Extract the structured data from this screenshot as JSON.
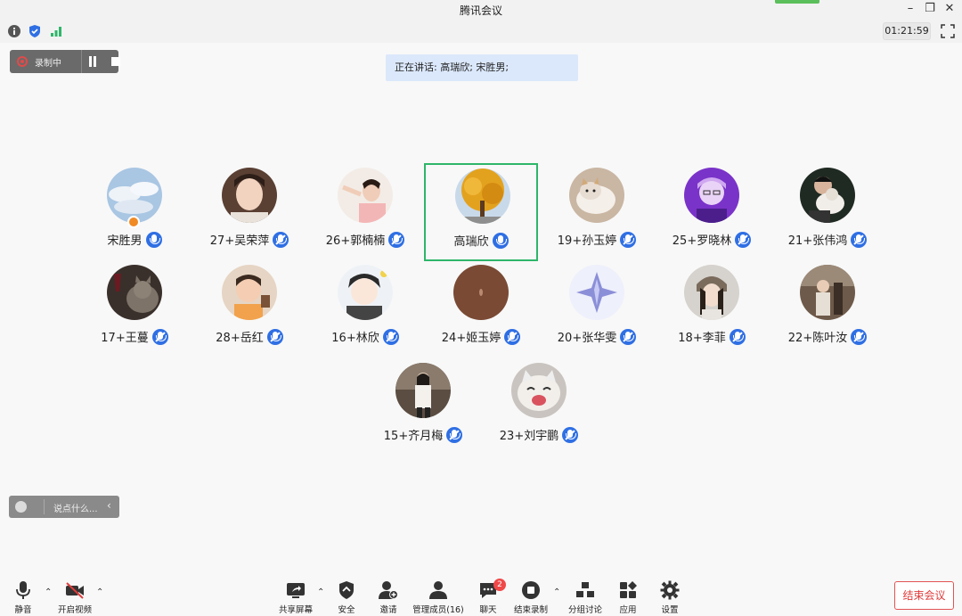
{
  "window": {
    "title": "腾讯会议",
    "timer": "01:21:59"
  },
  "recording": {
    "status_label": "录制中"
  },
  "speaking_banner": "正在讲话: 高瑞欣; 宋胜男;",
  "participants": [
    {
      "name": "宋胜男",
      "mic": "on",
      "avatar": "sky-clouds",
      "host": true
    },
    {
      "name": "27+吴荣萍",
      "mic": "muted",
      "avatar": "girl-portrait"
    },
    {
      "name": "26+郭楠楠",
      "mic": "muted",
      "avatar": "girl-pose"
    },
    {
      "name": "高瑞欣",
      "mic": "on",
      "avatar": "yellow-tree",
      "active_speaker": true
    },
    {
      "name": "19+孙玉婷",
      "mic": "muted",
      "avatar": "cat"
    },
    {
      "name": "25+罗晓林",
      "mic": "muted",
      "avatar": "purple-character"
    },
    {
      "name": "21+张伟鸿",
      "mic": "muted",
      "avatar": "person-with-cat"
    },
    {
      "name": "17+王蔓",
      "mic": "muted",
      "avatar": "cat-and-wine"
    },
    {
      "name": "28+岳红",
      "mic": "muted",
      "avatar": "baby"
    },
    {
      "name": "16+林欣",
      "mic": "muted",
      "avatar": "anime-boy"
    },
    {
      "name": "24+姬玉婷",
      "mic": "muted",
      "avatar": "brown-circle"
    },
    {
      "name": "20+张华雯",
      "mic": "muted",
      "avatar": "star-sticker"
    },
    {
      "name": "18+李菲",
      "mic": "muted",
      "avatar": "girl-hat"
    },
    {
      "name": "22+陈叶汝",
      "mic": "muted",
      "avatar": "person-outdoor"
    },
    {
      "name": "15+齐月梅",
      "mic": "muted",
      "avatar": "girl-street"
    },
    {
      "name": "23+刘宇鹏",
      "mic": "muted",
      "avatar": "laughing-cat"
    }
  ],
  "chat": {
    "placeholder": "说点什么..."
  },
  "toolbar": {
    "mute": "静音",
    "video": "开启视频",
    "share": "共享屏幕",
    "security": "安全",
    "invite": "邀请",
    "members": "管理成员(16)",
    "chat": "聊天",
    "chat_badge": "2",
    "end_recording": "结束录制",
    "breakout": "分组讨论",
    "apps": "应用",
    "settings": "设置",
    "end_meeting": "结束会议"
  },
  "colors": {
    "accent": "#2f6fe4",
    "active_speaker_border": "#2eb66a",
    "danger": "#e03c3c",
    "banner": "#dbe8fb"
  }
}
